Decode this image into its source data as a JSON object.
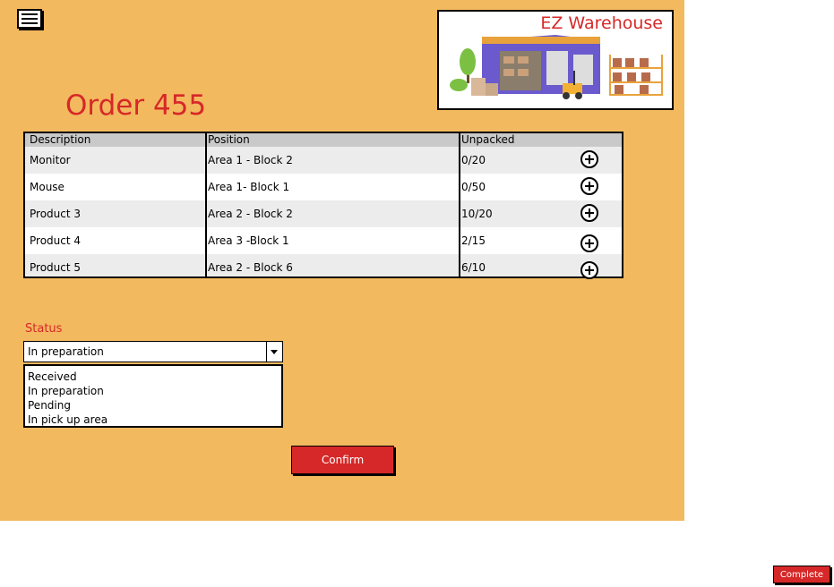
{
  "brand": {
    "name": "EZ Warehouse"
  },
  "order": {
    "title": "Order 455"
  },
  "table": {
    "headers": {
      "description": "Description",
      "position": "Position",
      "unpacked": "Unpacked"
    },
    "rows": [
      {
        "description": "Monitor",
        "position": "Area 1 - Block 2",
        "unpacked": "0/20"
      },
      {
        "description": "Mouse",
        "position": "Area 1- Block 1",
        "unpacked": "0/50"
      },
      {
        "description": "Product 3",
        "position": "Area 2 - Block 2",
        "unpacked": "10/20"
      },
      {
        "description": "Product 4",
        "position": "Area 3 -Block 1",
        "unpacked": "2/15"
      },
      {
        "description": "Product 5",
        "position": "Area 2 - Block 6",
        "unpacked": "6/10"
      }
    ]
  },
  "status": {
    "label": "Status",
    "selected": "In preparation",
    "options": [
      "Received",
      "In preparation",
      "Pending",
      "In pick up area"
    ]
  },
  "buttons": {
    "confirm": "Confirm",
    "complete": "Complete"
  },
  "icons": {
    "menu": "hamburger-menu-icon",
    "add": "plus-circle-icon",
    "dropdown": "chevron-down-icon"
  },
  "colors": {
    "background": "#f3b95f",
    "accent": "#d62828",
    "header_row": "#c9c9c9"
  }
}
